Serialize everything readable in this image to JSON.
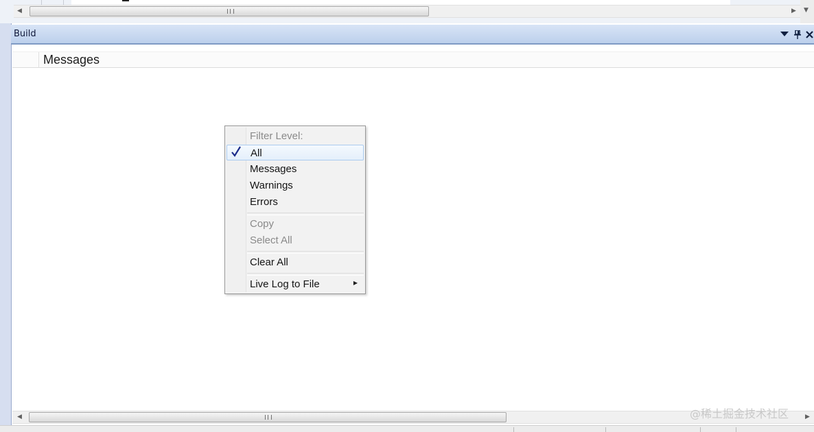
{
  "build_panel": {
    "title": "Build",
    "column_header": "Messages",
    "header_icons": [
      "chevron-down-icon",
      "pin-icon",
      "close-icon"
    ]
  },
  "context_menu": {
    "filter_level_label": "Filter Level:",
    "items": [
      {
        "label": "All",
        "checked": true,
        "enabled": true
      },
      {
        "label": "Messages",
        "checked": false,
        "enabled": true
      },
      {
        "label": "Warnings",
        "checked": false,
        "enabled": true
      },
      {
        "label": "Errors",
        "checked": false,
        "enabled": true
      },
      {
        "label": "Copy",
        "checked": false,
        "enabled": false
      },
      {
        "label": "Select All",
        "checked": false,
        "enabled": false
      },
      {
        "label": "Clear All",
        "checked": false,
        "enabled": true
      },
      {
        "label": "Live Log to File",
        "checked": false,
        "enabled": true,
        "submenu": true
      }
    ]
  },
  "watermark": "@稀土掘金技术社区",
  "colors": {
    "header_gradient_top": "#d8e4f6",
    "header_gradient_bottom": "#bcd0ec",
    "check_mark": "#1a2a8a",
    "menu_hover_border": "#aacbef",
    "disabled_text": "#8a8a8a"
  }
}
